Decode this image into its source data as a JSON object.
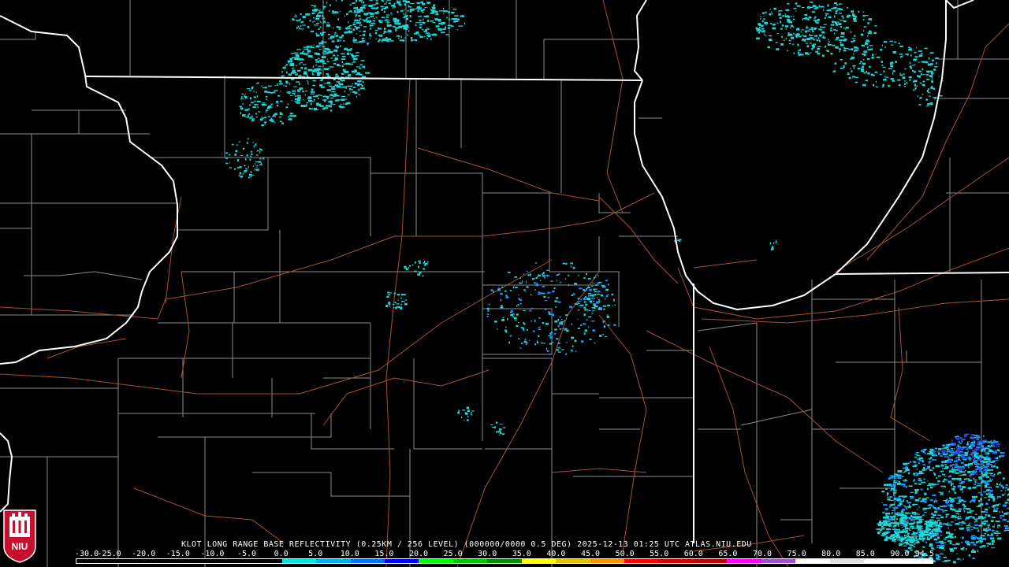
{
  "header": {
    "title": "KLOT LONG RANGE BASE REFLECTIVITY (0.25KM / 256 LEVEL) (000000/0000 0.5 DEG) 2025-12-13 01:25 UTC  ATLAS.NIU.EDU"
  },
  "logo": {
    "text": "NIU",
    "icon": "niu-tower-logo-icon"
  },
  "legend": {
    "ticks": [
      "-30.0",
      "-25.0",
      "-20.0",
      "-15.0",
      "-10.0",
      "-5.0",
      "0.0",
      "5.0",
      "10.0",
      "15.0",
      "20.0",
      "25.0",
      "30.0",
      "35.0",
      "40.0",
      "45.0",
      "50.0",
      "55.0",
      "60.0",
      "65.0",
      "70.0",
      "75.0",
      "80.0",
      "85.0",
      "90.0",
      "94.5"
    ],
    "colors": [
      "#000000",
      "#000000",
      "#000000",
      "#000000",
      "#000000",
      "#000000",
      "#00e6e6",
      "#00b0f0",
      "#0070ff",
      "#0000ff",
      "#00ff00",
      "#00c800",
      "#008c00",
      "#ffff00",
      "#e6c000",
      "#ff9000",
      "#ff0000",
      "#d60000",
      "#c00000",
      "#ff00ff",
      "#9955c9",
      "#ffffff",
      "#e0e0e0",
      "#ffffff",
      "#ffffff"
    ]
  },
  "map": {
    "colors": {
      "state_line": "#ffffff",
      "county_line": "#8c8c8c",
      "highway": "#a8522e",
      "echo_light": "#1fd6d6",
      "echo_medium": "#1e8cff",
      "echo_strong": "#2a40e8"
    }
  }
}
